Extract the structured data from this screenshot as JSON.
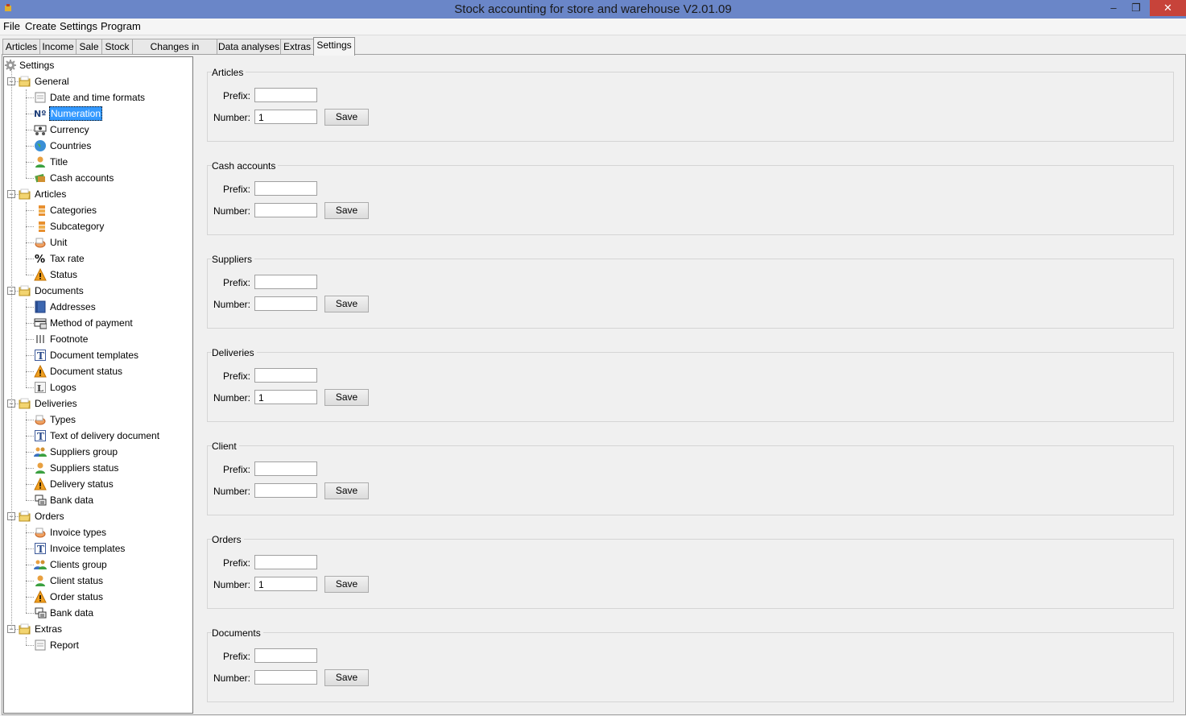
{
  "window": {
    "title": "Stock accounting for store and warehouse V2.01.09",
    "min": "–",
    "max": "❐",
    "close": "✕"
  },
  "menu": [
    "File",
    "Create",
    "Settings",
    "Program"
  ],
  "tabs": [
    "Articles",
    "Income",
    "Sale",
    "Stock",
    "Changes in stocking",
    "Data analyses",
    "Extras",
    "Settings"
  ],
  "active_tab": "Settings",
  "tree": {
    "root": "Settings",
    "groups": [
      {
        "label": "General",
        "items": [
          {
            "label": "Date and time formats",
            "icon": "calendar-icon"
          },
          {
            "label": "Numeration",
            "icon": "numero-icon",
            "selected": true
          },
          {
            "label": "Currency",
            "icon": "currency-icon"
          },
          {
            "label": "Countries",
            "icon": "globe-icon"
          },
          {
            "label": "Title",
            "icon": "person-icon"
          },
          {
            "label": "Cash accounts",
            "icon": "cash-icon"
          }
        ]
      },
      {
        "label": "Articles",
        "items": [
          {
            "label": "Categories",
            "icon": "category-icon"
          },
          {
            "label": "Subcategory",
            "icon": "category-icon"
          },
          {
            "label": "Unit",
            "icon": "unit-icon"
          },
          {
            "label": "Tax rate",
            "icon": "percent-icon"
          },
          {
            "label": "Status",
            "icon": "warning-icon"
          }
        ]
      },
      {
        "label": "Documents",
        "items": [
          {
            "label": "Addresses",
            "icon": "address-book-icon"
          },
          {
            "label": "Method of payment",
            "icon": "payment-icon"
          },
          {
            "label": "Footnote",
            "icon": "footnote-icon"
          },
          {
            "label": "Document templates",
            "icon": "template-icon"
          },
          {
            "label": "Document status",
            "icon": "warning-icon"
          },
          {
            "label": "Logos",
            "icon": "logo-icon"
          }
        ]
      },
      {
        "label": "Deliveries",
        "items": [
          {
            "label": "Types",
            "icon": "unit-icon"
          },
          {
            "label": "Text of delivery document",
            "icon": "template-icon"
          },
          {
            "label": "Suppliers group",
            "icon": "group-icon"
          },
          {
            "label": "Suppliers status",
            "icon": "person-icon"
          },
          {
            "label": "Delivery status",
            "icon": "warning-icon"
          },
          {
            "label": "Bank data",
            "icon": "bank-icon"
          }
        ]
      },
      {
        "label": "Orders",
        "items": [
          {
            "label": "Invoice types",
            "icon": "unit-icon"
          },
          {
            "label": "Invoice templates",
            "icon": "template-icon"
          },
          {
            "label": "Clients group",
            "icon": "group-icon"
          },
          {
            "label": "Client status",
            "icon": "person-icon"
          },
          {
            "label": "Order status",
            "icon": "warning-icon"
          },
          {
            "label": "Bank data",
            "icon": "bank-icon"
          }
        ]
      },
      {
        "label": "Extras",
        "items": [
          {
            "label": "Report",
            "icon": "calendar-icon"
          }
        ]
      }
    ]
  },
  "form": {
    "prefix_label": "Prefix:",
    "number_label": "Number:",
    "save_label": "Save",
    "sections": [
      {
        "title": "Articles",
        "prefix": "",
        "number": "1"
      },
      {
        "title": "Cash accounts",
        "prefix": "",
        "number": ""
      },
      {
        "title": "Suppliers",
        "prefix": "",
        "number": ""
      },
      {
        "title": "Deliveries",
        "prefix": "",
        "number": "1"
      },
      {
        "title": "Client",
        "prefix": "",
        "number": ""
      },
      {
        "title": "Orders",
        "prefix": "",
        "number": "1"
      },
      {
        "title": "Documents",
        "prefix": "",
        "number": ""
      }
    ]
  },
  "colors": {
    "titlebar": "#6a86c8",
    "selection": "#3399ff",
    "close": "#c7433a"
  }
}
